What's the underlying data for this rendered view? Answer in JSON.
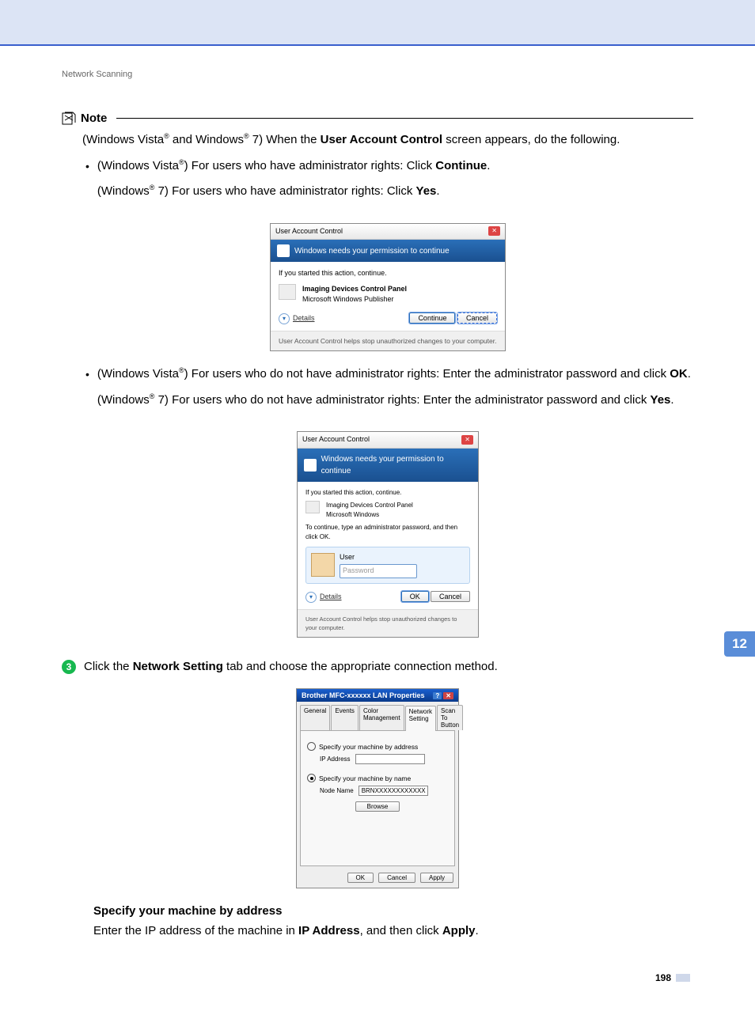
{
  "breadcrumb": "Network Scanning",
  "note": {
    "label": "Note",
    "intro_pre": "(Windows Vista",
    "intro_mid": " and Windows",
    "intro_post": " 7) When the ",
    "intro_bold": "User Account Control",
    "intro_end": " screen appears, do the following.",
    "b1_pre": "(Windows Vista",
    "b1_post": ") For users who have administrator rights: Click ",
    "b1_bold": "Continue",
    "b1_end": ".",
    "b1b_pre": "(Windows",
    "b1b_post": " 7) For users who have administrator rights: Click ",
    "b1b_bold": "Yes",
    "b1b_end": ".",
    "b2_pre": "(Windows Vista",
    "b2_post": ") For users who do not have administrator rights: Enter the administrator password and click ",
    "b2_bold": "OK",
    "b2_end": ".",
    "b2b_pre": "(Windows",
    "b2b_post": " 7) For users who do not have administrator rights: Enter the administrator password and click ",
    "b2b_bold": "Yes",
    "b2b_end": "."
  },
  "dlg1": {
    "title": "User Account Control",
    "banner": "Windows needs your permission to continue",
    "line1": "If you started this action, continue.",
    "prog1": "Imaging Devices Control Panel",
    "prog2": "Microsoft Windows Publisher",
    "details": "Details",
    "btn1": "Continue",
    "btn2": "Cancel",
    "foot": "User Account Control helps stop unauthorized changes to your computer."
  },
  "dlg2": {
    "title": "User Account Control",
    "banner": "Windows needs your permission to continue",
    "line1": "If you started this action, continue.",
    "prog1": "Imaging Devices Control Panel",
    "prog2": "Microsoft Windows",
    "line2": "To continue, type an administrator password, and then click OK.",
    "user": "User",
    "pw_ph": "Password",
    "details": "Details",
    "btn1": "OK",
    "btn2": "Cancel",
    "foot": "User Account Control helps stop unauthorized changes to your computer."
  },
  "step3": {
    "num": "3",
    "text_pre": "Click the ",
    "text_bold": "Network Setting",
    "text_post": " tab and choose the appropriate connection method."
  },
  "props": {
    "title": "Brother  MFC-xxxxxx   LAN Properties",
    "tabs": [
      "General",
      "Events",
      "Color Management",
      "Network Setting",
      "Scan To Button"
    ],
    "active_tab": 3,
    "radio1": "Specify your machine by address",
    "ip_label": "IP Address",
    "radio2": "Specify your machine by name",
    "node_label": "Node Name",
    "node_value": "BRNXXXXXXXXXXXX",
    "browse": "Browse",
    "ok": "OK",
    "cancel": "Cancel",
    "apply": "Apply"
  },
  "spec": {
    "head": "Specify your machine by address",
    "body_pre": "Enter the IP address of the machine in ",
    "body_b1": "IP Address",
    "body_mid": ", and then click ",
    "body_b2": "Apply",
    "body_end": "."
  },
  "side": "12",
  "pagenum": "198"
}
